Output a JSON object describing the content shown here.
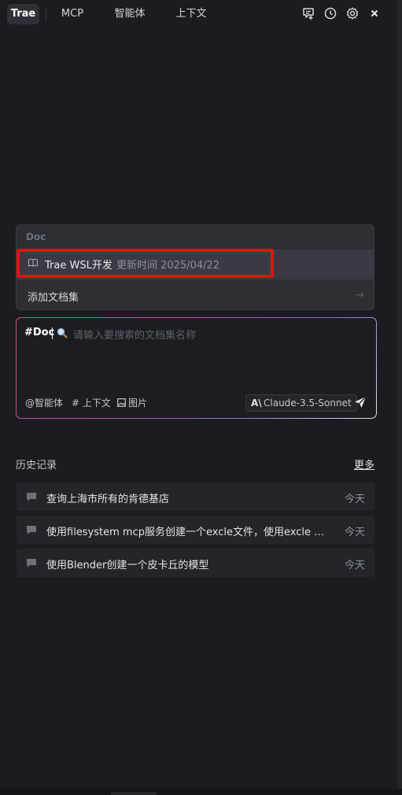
{
  "tabs": [
    {
      "label": "Trae",
      "active": true
    },
    {
      "label": "MCP",
      "active": false
    },
    {
      "label": "智能体",
      "active": false
    },
    {
      "label": "上下文",
      "active": false
    }
  ],
  "top_icons": [
    "new-chat-icon",
    "history-icon",
    "settings-icon",
    "close-icon"
  ],
  "doc_panel": {
    "header": "Doc",
    "item": {
      "name": "Trae WSL开发",
      "updated": "更新时间 2025/04/22"
    },
    "add_label": "添加文档集",
    "add_arrow": "→"
  },
  "input": {
    "tag": "#Doc",
    "placeholder": "请输入要搜索的文档集名称",
    "tools": {
      "agent": "智能体",
      "context": "上下文",
      "image": "图片"
    },
    "at": "@",
    "hash": "#",
    "model": "Claude-3.5-Sonnet",
    "model_logo": "A\\"
  },
  "history": {
    "title": "历史记录",
    "more": "更多",
    "items": [
      {
        "text": "查询上海市所有的肯德基店",
        "time": "今天"
      },
      {
        "text": "使用filesystem mcp服务创建一个excle文件，使用excle mcp服务修改一下这个文件的内容",
        "time": "今天"
      },
      {
        "text": "使用Blender创建一个皮卡丘的模型",
        "time": "今天"
      }
    ]
  },
  "colors": {
    "background": "#1b1c21",
    "highlight": "#e01414",
    "panel": "#2e2f35"
  }
}
